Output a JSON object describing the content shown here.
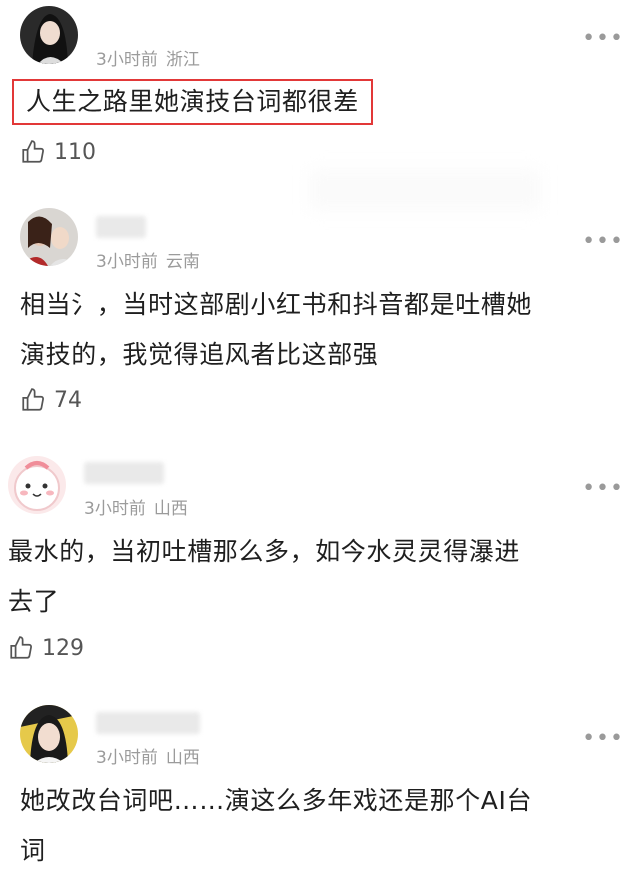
{
  "comments": [
    {
      "time": "3小时前",
      "location": "浙江",
      "text": "人生之路里她演技台词都很差",
      "likes": "110",
      "highlighted": true
    },
    {
      "time": "3小时前",
      "location": "云南",
      "text_line1": "相当氵，当时这部剧小红书和抖音都是吐槽她",
      "text_line2": "演技的，我觉得追风者比这部强",
      "likes": "74"
    },
    {
      "time": "3小时前",
      "location": "山西",
      "text_line1": "最水的，当初吐槽那么多，如今水灵灵得瀑进",
      "text_line2": "去了",
      "likes": "129"
    },
    {
      "time": "3小时前",
      "location": "山西",
      "text_line1": "她改改台词吧……演这么多年戏还是那个AI台",
      "text_line2": "词"
    }
  ],
  "colors": {
    "highlight_border": "#e23838",
    "meta_gray": "#9b9b9b",
    "text": "#1f1f1f"
  },
  "icons": [
    "thumb-up-icon",
    "more-dots-icon",
    "avatar"
  ]
}
